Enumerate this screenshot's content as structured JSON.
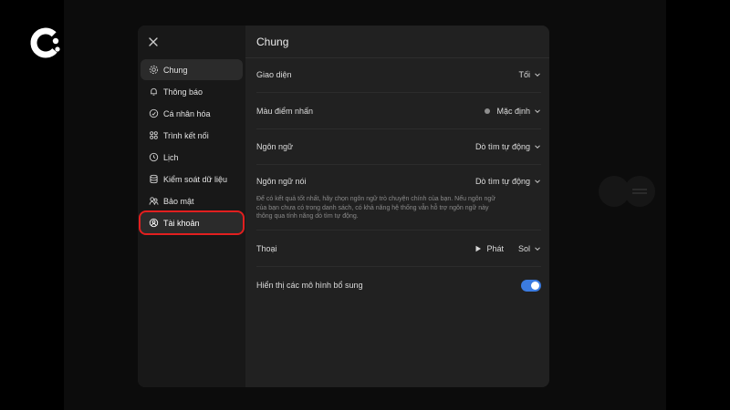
{
  "sidebar": {
    "items": [
      {
        "label": "Chung",
        "icon": "gear-icon"
      },
      {
        "label": "Thông báo",
        "icon": "bell-icon"
      },
      {
        "label": "Cá nhân hóa",
        "icon": "personalize-icon"
      },
      {
        "label": "Trình kết nối",
        "icon": "connectors-icon"
      },
      {
        "label": "Lịch",
        "icon": "clock-icon"
      },
      {
        "label": "Kiểm soát dữ liệu",
        "icon": "database-icon"
      },
      {
        "label": "Bảo mật",
        "icon": "security-icon"
      },
      {
        "label": "Tài khoản",
        "icon": "account-icon"
      }
    ]
  },
  "main": {
    "title": "Chung",
    "settings": {
      "theme": {
        "label": "Giao diện",
        "value": "Tối"
      },
      "accent": {
        "label": "Màu điểm nhấn",
        "value": "Mặc định"
      },
      "language": {
        "label": "Ngôn ngữ",
        "value": "Dò tìm tự động"
      },
      "spoken_language": {
        "label": "Ngôn ngữ nói",
        "value": "Dò tìm tự động",
        "hint": "Để có kết quả tốt nhất, hãy chọn ngôn ngữ trò chuyện chính của bạn. Nếu ngôn ngữ của bạn chưa có trong danh sách, có khả năng hệ thống vẫn hỗ trợ ngôn ngữ này thông qua tính năng dò tìm tự động."
      },
      "voice": {
        "label": "Thoại",
        "play_label": "Phát",
        "value": "Sol"
      },
      "extra_models": {
        "label": "Hiển thị các mô hình bổ sung",
        "enabled": true
      }
    }
  },
  "colors": {
    "accent": "#3b7be0",
    "highlight": "#e11d1d",
    "modal_bg": "#212121",
    "sidebar_bg": "#181818"
  }
}
